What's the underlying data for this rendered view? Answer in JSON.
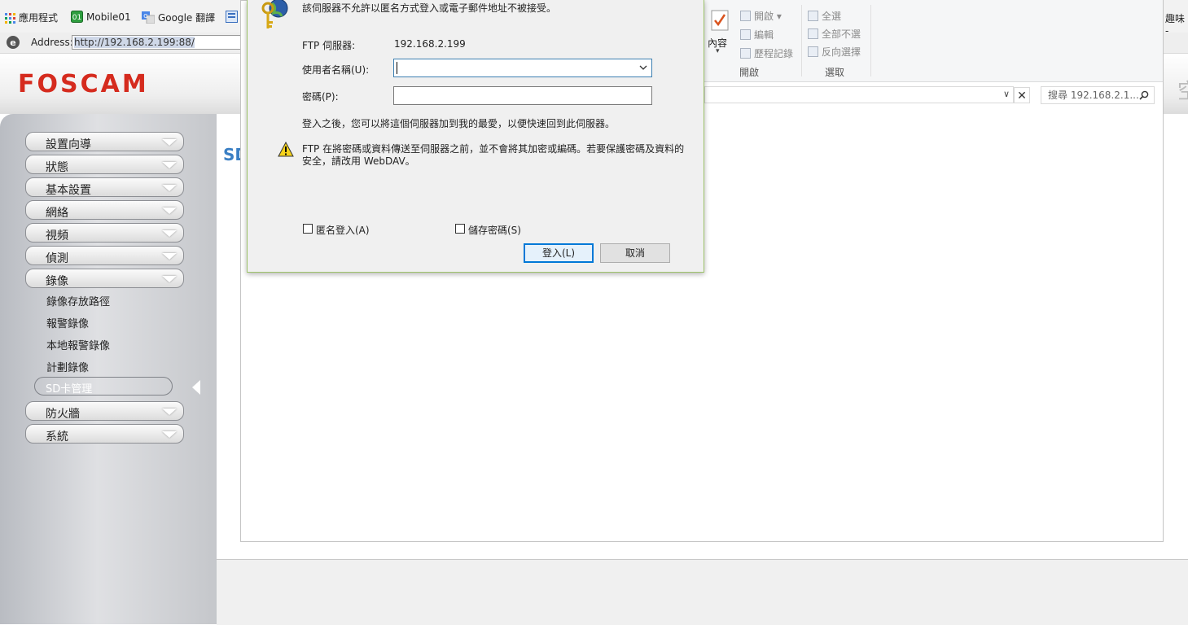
{
  "bookmarks": {
    "items": [
      {
        "label": "應用程式",
        "icon": "apps-grid-icon"
      },
      {
        "label": "Mobile01",
        "icon": "mobile01-icon"
      },
      {
        "label": "Google 翻譯",
        "icon": "google-translate-icon"
      }
    ],
    "right_text": "趣味 -"
  },
  "address_bar": {
    "label": "Address:",
    "url": "http://192.168.2.199:88/"
  },
  "camera": {
    "logo": "FOSCAM",
    "section_title_fragment": "SD",
    "menu": [
      {
        "label": "設置向導"
      },
      {
        "label": "狀態"
      },
      {
        "label": "基本設置"
      },
      {
        "label": "網絡"
      },
      {
        "label": "視頻"
      },
      {
        "label": "偵測"
      },
      {
        "label": "錄像"
      }
    ],
    "submenu": [
      {
        "label": "錄像存放路徑"
      },
      {
        "label": "報警錄像"
      },
      {
        "label": "本地報警錄像"
      },
      {
        "label": "計劃錄像"
      }
    ],
    "active_submenu": "SD卡管理",
    "menu_after": [
      {
        "label": "防火牆"
      },
      {
        "label": "系統"
      }
    ]
  },
  "explorer": {
    "ribbon": {
      "properties_label": "內容",
      "open_group": {
        "items": [
          {
            "label": "開啟 ▾"
          },
          {
            "label": "編輯"
          },
          {
            "label": "歷程記錄"
          }
        ],
        "group_label": "開啟"
      },
      "select_group": {
        "items": [
          {
            "label": "全選"
          },
          {
            "label": "全部不選"
          },
          {
            "label": "反向選擇"
          }
        ],
        "group_label": "選取"
      }
    },
    "search_placeholder": "搜尋 192.168.2.1...",
    "close_symbol": "✕",
    "partial_right_char": "空"
  },
  "dialog": {
    "message": "該伺服器不允許以匿名方式登入或電子郵件地址不被接受。",
    "server_label": "FTP 伺服器:",
    "server_value": "192.168.2.199",
    "username_label": "使用者名稱(U):",
    "username_value": "",
    "password_label": "密碼(P):",
    "password_value": "",
    "favorites_note": "登入之後，您可以將這個伺服器加到我的最愛，以便快速回到此伺服器。",
    "warning_line1": "FTP 在將密碼或資料傳送至伺服器之前，並不會將其加密或編碼。若要保護密碼及資料的",
    "warning_line2": "安全，請改用 WebDAV。",
    "anonymous_label": "匿名登入(A)",
    "anonymous_checked": false,
    "save_password_label": "儲存密碼(S)",
    "save_password_checked": false,
    "login_button": "登入(L)",
    "cancel_button": "取消"
  }
}
